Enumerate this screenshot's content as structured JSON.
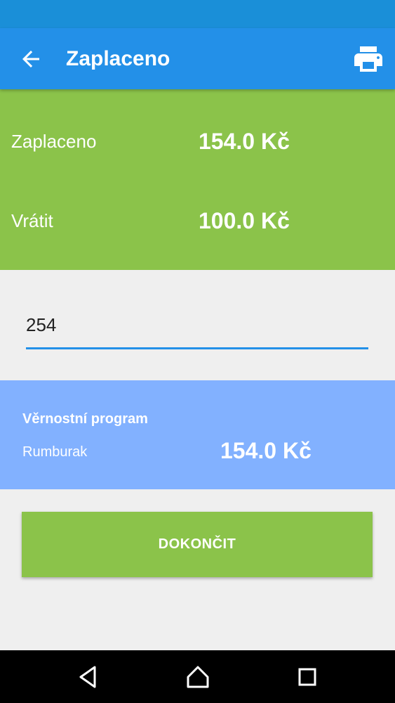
{
  "app_bar": {
    "title": "Zaplaceno",
    "back_icon": "arrow-back-icon",
    "print_icon": "printer-icon",
    "color": "#2390e8"
  },
  "summary": {
    "paid_label": "Zaplaceno",
    "paid_value": "154.0 Kč",
    "change_label": "Vrátit",
    "change_value": "100.0 Kč",
    "color": "#8bc34a"
  },
  "input": {
    "value": "254"
  },
  "loyalty": {
    "title": "Věrnostní program",
    "name": "Rumburak",
    "value": "154.0 Kč",
    "color": "#82b1ff"
  },
  "actions": {
    "finish_label": "DOKONČIT"
  },
  "nav_bar": {
    "back_icon": "nav-back-icon",
    "home_icon": "nav-home-icon",
    "recents_icon": "nav-recents-icon"
  }
}
